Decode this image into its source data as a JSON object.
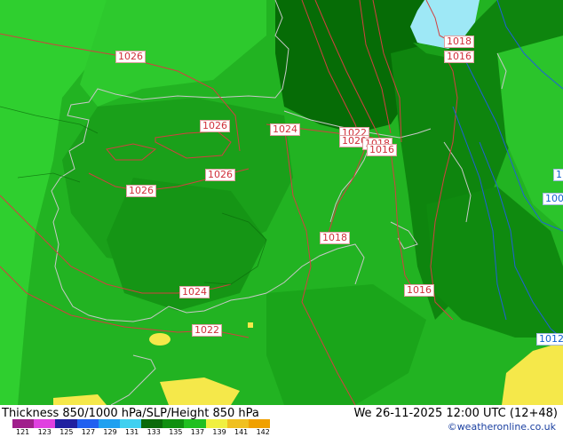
{
  "map": {
    "isobar_labels": [
      {
        "text": "1026",
        "kind": "red"
      },
      {
        "text": "1026",
        "kind": "red"
      },
      {
        "text": "1026",
        "kind": "red"
      },
      {
        "text": "1026",
        "kind": "red"
      },
      {
        "text": "1024",
        "kind": "red"
      },
      {
        "text": "1024",
        "kind": "red"
      },
      {
        "text": "1022",
        "kind": "red"
      },
      {
        "text": "1022",
        "kind": "red"
      },
      {
        "text": "1020",
        "kind": "red"
      },
      {
        "text": "1018",
        "kind": "red"
      },
      {
        "text": "1018",
        "kind": "red"
      },
      {
        "text": "1018",
        "kind": "red"
      },
      {
        "text": "1016",
        "kind": "red"
      },
      {
        "text": "1016",
        "kind": "red"
      },
      {
        "text": "1016",
        "kind": "red"
      },
      {
        "text": "1012",
        "kind": "blue"
      },
      {
        "text": "100",
        "kind": "blue"
      },
      {
        "text": "1",
        "kind": "blue"
      }
    ],
    "colors": {
      "thickness_main": "#22b322",
      "thickness_light": "#2fcf2f",
      "thickness_dark": "#0a7a0a",
      "thickness_darkest": "#056805",
      "warm_yellow": "#f5e84a",
      "water": "#9ee8f6",
      "coastline": "#c8c8c8",
      "isobar_red": "#d24040",
      "isobar_blue": "#1060d0"
    }
  },
  "footer": {
    "title": "Thickness 850/1000 hPa/SLP/Height 850 hPa",
    "datetime": "We 26-11-2025 12:00 UTC (12+48)",
    "copyright": "©weatheronline.co.uk"
  },
  "legend": {
    "ticks": [
      "121",
      "123",
      "125",
      "127",
      "129",
      "131",
      "133",
      "135",
      "137",
      "139",
      "141",
      "142"
    ],
    "colors": [
      "#a0208c",
      "#e040e0",
      "#2020a0",
      "#2060f0",
      "#20a0f0",
      "#40d0f0",
      "#0a6a0a",
      "#109010",
      "#20c020",
      "#f0f040",
      "#f0c020",
      "#f0a000"
    ]
  }
}
